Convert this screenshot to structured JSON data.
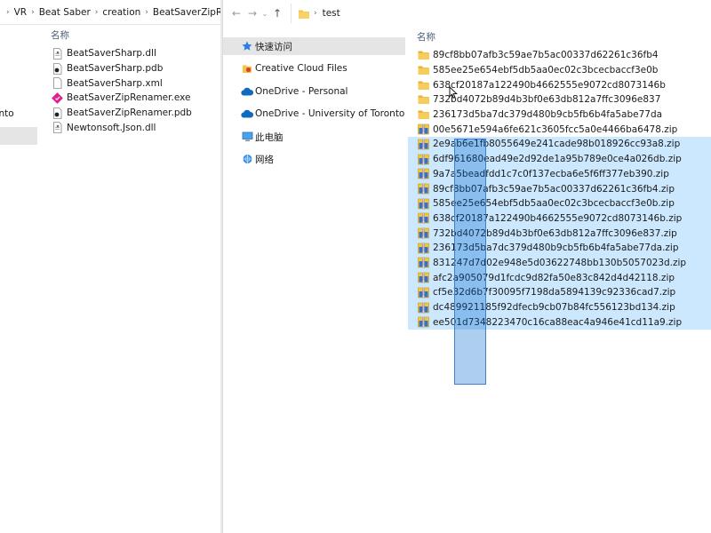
{
  "left_window": {
    "breadcrumb": [
      "VR",
      "Beat Saber",
      "creation",
      "BeatSaverZipRenam"
    ],
    "nav_items": [
      {
        "label": "ronto",
        "selected": false
      },
      {
        "label": "",
        "selected": true
      }
    ],
    "column_header": "名称",
    "files": [
      {
        "name": "BeatSaverSharp.dll",
        "icon": "dll-file-icon"
      },
      {
        "name": "BeatSaverSharp.pdb",
        "icon": "pdb-file-icon"
      },
      {
        "name": "BeatSaverSharp.xml",
        "icon": "xml-file-icon"
      },
      {
        "name": "BeatSaverZipRenamer.exe",
        "icon": "exe-file-icon"
      },
      {
        "name": "BeatSaverZipRenamer.pdb",
        "icon": "pdb-file-icon"
      },
      {
        "name": "Newtonsoft.Json.dll",
        "icon": "dll-file-icon"
      }
    ]
  },
  "right_window": {
    "breadcrumb": [
      "test"
    ],
    "nav_items": [
      {
        "label": "快速访问",
        "icon": "star-icon",
        "selected": true
      },
      {
        "label": "Creative Cloud Files",
        "icon": "creative-cloud-icon",
        "selected": false
      },
      {
        "label": "OneDrive - Personal",
        "icon": "cloud-icon",
        "selected": false
      },
      {
        "label": "OneDrive - University of Toronto",
        "icon": "cloud-icon",
        "selected": false
      },
      {
        "label": "此电脑",
        "icon": "computer-icon",
        "selected": false
      },
      {
        "label": "网络",
        "icon": "network-icon",
        "selected": false
      }
    ],
    "column_header": "名称",
    "items": [
      {
        "name": "89cf8bb07afb3c59ae7b5ac00337d62261c36fb4",
        "type": "folder",
        "selected": false
      },
      {
        "name": "585ee25e654ebf5db5aa0ec02c3bcecbaccf3e0b",
        "type": "folder",
        "selected": false
      },
      {
        "name": "638cf20187a122490b4662555e9072cd8073146b",
        "type": "folder",
        "selected": false
      },
      {
        "name": "732bd4072b89d4b3bf0e63db812a7ffc3096e837",
        "type": "folder",
        "selected": false
      },
      {
        "name": "236173d5ba7dc379d480b9cb5fb6b4fa5abe77da",
        "type": "folder",
        "selected": false
      },
      {
        "name": "00e5671e594a6fe621c3605fcc5a0e4466ba6478.zip",
        "type": "zip",
        "selected": false
      },
      {
        "name": "2e9ab6e1fb8055649e241cade98b018926cc93a8.zip",
        "type": "zip",
        "selected": true
      },
      {
        "name": "6df961680ead49e2d92de1a95b789e0ce4a026db.zip",
        "type": "zip",
        "selected": true
      },
      {
        "name": "9a7a5beadfdd1c7c0f137ecba6e5f6ff377eb390.zip",
        "type": "zip",
        "selected": true
      },
      {
        "name": "89cf8bb07afb3c59ae7b5ac00337d62261c36fb4.zip",
        "type": "zip",
        "selected": true
      },
      {
        "name": "585ee25e654ebf5db5aa0ec02c3bcecbaccf3e0b.zip",
        "type": "zip",
        "selected": true
      },
      {
        "name": "638cf20187a122490b4662555e9072cd8073146b.zip",
        "type": "zip",
        "selected": true
      },
      {
        "name": "732bd4072b89d4b3bf0e63db812a7ffc3096e837.zip",
        "type": "zip",
        "selected": true
      },
      {
        "name": "236173d5ba7dc379d480b9cb5fb6b4fa5abe77da.zip",
        "type": "zip",
        "selected": true
      },
      {
        "name": "831247d7d02e948e5d03622748bb130b5057023d.zip",
        "type": "zip",
        "selected": true
      },
      {
        "name": "afc2a905079d1fcdc9d82fa50e83c842d4d42118.zip",
        "type": "zip",
        "selected": true
      },
      {
        "name": "cf5e32d6b7f30095f7198da5894139c92336cad7.zip",
        "type": "zip",
        "selected": true
      },
      {
        "name": "dc489921185f92dfecb9cb07b84fc556123bd134.zip",
        "type": "zip",
        "selected": true
      },
      {
        "name": "ee501d7348223470c16ca88eac4a946e41cd11a9.zip",
        "type": "zip",
        "selected": true
      }
    ]
  },
  "colors": {
    "selection": "#cce8ff",
    "marquee": "#3f7fd1",
    "folder": "#f4c542",
    "nav_selected": "#e5e5e5",
    "header_text": "#4c607a"
  }
}
